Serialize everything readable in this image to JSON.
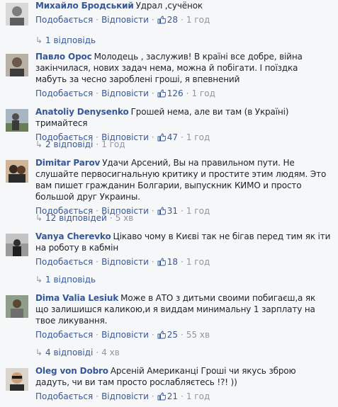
{
  "labels": {
    "like": "Подобається",
    "reply": "Відповісти",
    "dot": "·"
  },
  "comments": [
    {
      "author": "Михайло Бродський",
      "text": "Удрал ,сучёнок",
      "likes": "28",
      "time": "1 год",
      "replies": {
        "label": "1 відповідь",
        "time": ""
      }
    },
    {
      "author": "Павло Орос",
      "text": "Молодець , заслужив! В країні все добре, війна закінчилася, нових задач нема, можна й побігати. І поїздка мабуть за чесно зароблені гроші, я впевнений",
      "likes": "126",
      "time": "1 год",
      "replies": null
    },
    {
      "author": "Anatoliy Denysenko",
      "text": "Грошей нема, але ви там (в Україні) тримайтеся",
      "likes": "47",
      "time": "1 год",
      "replies": {
        "label": "2 відповіді",
        "time": "1 год"
      }
    },
    {
      "author": "Dimitar Parov",
      "text": "Удачи Арсений, Вы на правильном пути. Не слушайте первосигнальную критику и простите этим людям. Это вам пишет гражданин Болгарии, выпускник КИМО и просто большой друг Украины.",
      "likes": "31",
      "time": "1 год",
      "replies": {
        "label": "12 відповідей",
        "time": "5 хв"
      }
    },
    {
      "author": "Vanya Cherevko",
      "text": "Цікаво чому в Києві так не бігав перед тим як іти на роботу в кабмін",
      "likes": "18",
      "time": "1 год",
      "replies": {
        "label": "1 відповідь",
        "time": ""
      }
    },
    {
      "author": "Dima Valia Lesiuk",
      "text": "Може в АТО з дитьми своими побигаєш,а як що залишишся каликою,и я виддам минимальну 1 зарплату на твое ликування.",
      "likes": "25",
      "time": "55 хв",
      "replies": {
        "label": "4 відповіді",
        "time": "4 хв"
      }
    },
    {
      "author": "Oleg von Dobro",
      "text": "Арсеній Американці Гроші чи якусь зброю дадуть, чи ви там просто рослабляєтесь !?! ))",
      "likes": "21",
      "time": "1 год",
      "replies": null
    }
  ]
}
